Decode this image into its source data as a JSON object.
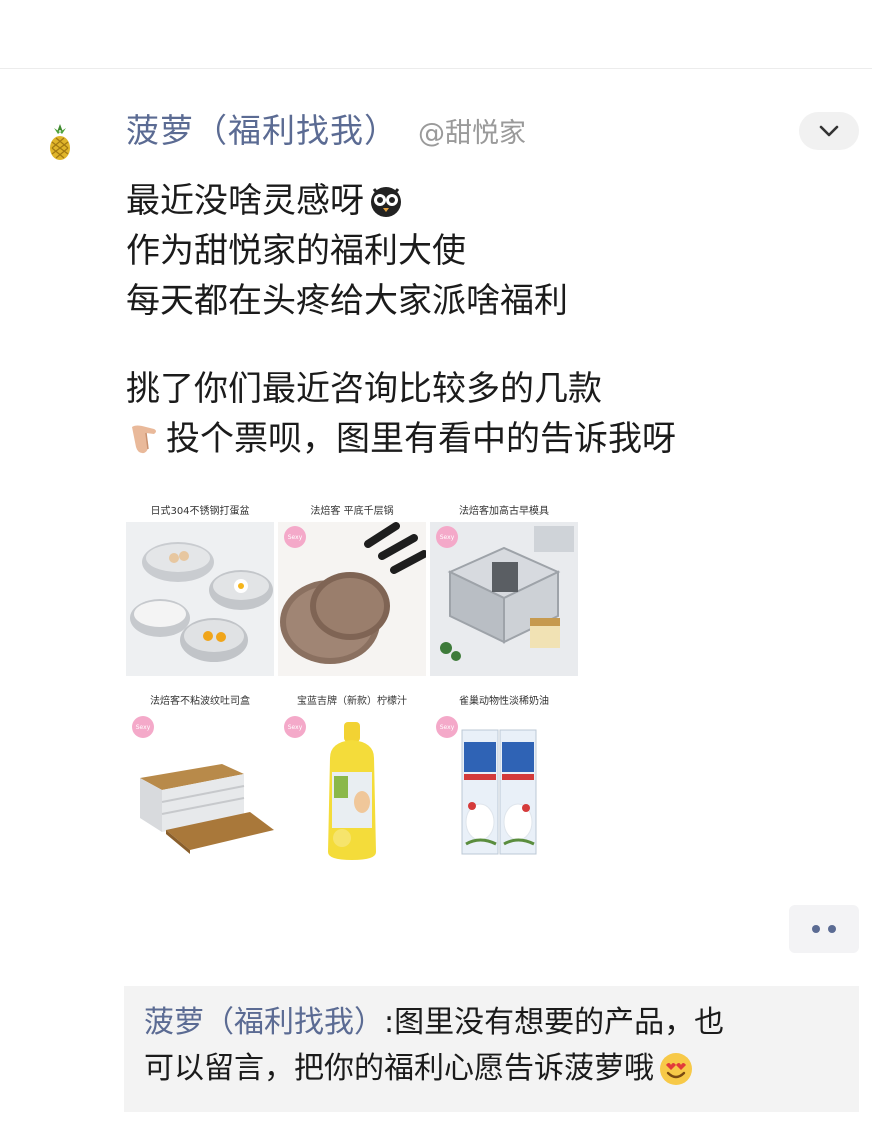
{
  "post": {
    "author_name": "菠萝（福利找我）",
    "author_handle": "@甜悦家",
    "lines": [
      "最近没啥灵感呀",
      "作为甜悦家的福利大使",
      "每天都在头疼给大家派啥福利",
      "挑了你们最近咨询比较多的几款",
      "投个票呗，图里有看中的告诉我呀"
    ],
    "emoji": [
      "owl-face",
      "pointing-hand"
    ]
  },
  "products": [
    {
      "title": "日式304不锈钢打蛋盆",
      "image": "stainless-bowls"
    },
    {
      "title": "法焙客 平底千层锅",
      "image": "crepe-pans",
      "badge": "Sexy"
    },
    {
      "title": "法焙客加高古早模具",
      "image": "square-molds",
      "badge": "Sexy"
    },
    {
      "title": "法焙客不粘波纹吐司盒",
      "image": "toast-box",
      "badge": "Sexy"
    },
    {
      "title": "宝蓝吉牌（新款）柠檬汁",
      "image": "lemon-juice",
      "badge": "Sexy"
    },
    {
      "title": "雀巢动物性淡稀奶油",
      "image": "whipping-cream",
      "badge": "Sexy"
    }
  ],
  "comment": {
    "author": "菠萝（福利找我）",
    "separator": ":",
    "line1": "图里没有想要的产品，也",
    "line2": "可以留言，把你的福利心愿告诉菠萝哦",
    "emoji": "heart-eyes-smile"
  },
  "colors": {
    "link": "#5b6b93",
    "handle": "#9a9a9a",
    "badge": "#f4a9c9",
    "comment_bg": "#f3f3f3"
  },
  "icons": {
    "avatar": "pineapple-icon",
    "more": "chevron-down-icon",
    "actions": "more-dots-icon"
  }
}
